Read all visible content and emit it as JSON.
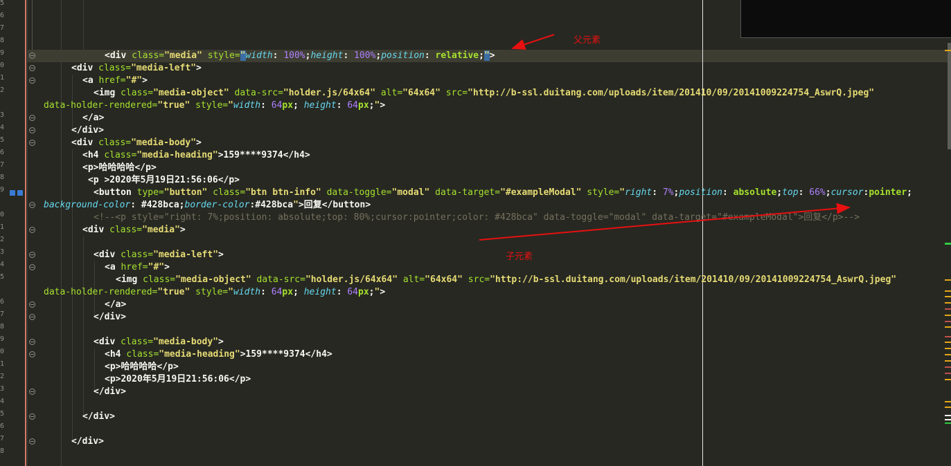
{
  "annotations": {
    "parent_label": "父元素",
    "child_label": "子元素"
  },
  "line_numbers": [
    "5",
    "6",
    "7",
    "8",
    "9",
    "0",
    "1",
    "2",
    "",
    "3",
    "4",
    "5",
    "6",
    "7",
    "8",
    "9",
    "",
    "0",
    "1",
    "2",
    "3",
    "4",
    "5",
    "",
    "6",
    "7",
    "8",
    "9",
    "0",
    "1",
    "2",
    "3",
    "4",
    "5",
    "6",
    "7",
    "8"
  ],
  "colors": {
    "background": "#272822",
    "annotation": "#e81010",
    "tag": "#f8f8f2",
    "attribute": "#a6e22e",
    "string": "#e6db74",
    "property": "#66d9ef",
    "number": "#ae81ff",
    "comment": "#75715e"
  },
  "code": {
    "l05": {
      "t1": "<div ",
      "a1": "class=",
      "s1": "\"media\"",
      "a2": " style=",
      "s2": "\"",
      "p1": "width",
      "t2": ": ",
      "n1": "100%",
      "t3": ";",
      "p2": "height",
      "t4": ": ",
      "n2": "100%",
      "t5": ";",
      "p3": "position",
      "t6": ": ",
      "k1": "relative",
      "t7": ";",
      "s3": "\"",
      "t8": ">"
    },
    "l06": {
      "t1": "<div ",
      "a1": "class=",
      "s1": "\"media-left\"",
      "t2": ">"
    },
    "l07": {
      "t1": "<a ",
      "a1": "href=",
      "s1": "\"#\"",
      "t2": ">"
    },
    "l08": {
      "t1": "<img ",
      "a1": "class=",
      "s1": "\"media-object\"",
      "a2": " data-src=",
      "s2": "\"holder.js/64x64\"",
      "a3": " alt=",
      "s3": "\"64x64\"",
      "a4": " src=",
      "s4": "\"http://b-ssl.duitang.com/uploads/item/201410/09/20141009224754_AswrQ.jpeg\""
    },
    "l08b": {
      "a1": "data-holder-rendered=",
      "s1": "\"true\"",
      "a2": " style=",
      "s2": "\"",
      "p1": "width",
      "t1": ": ",
      "n1": "64",
      "k1": "px",
      "t2": "; ",
      "p2": "height",
      "t3": ": ",
      "n2": "64",
      "k2": "px",
      "t4": ";",
      "s3": "\"",
      "t5": ">"
    },
    "l09": {
      "t1": "</a>"
    },
    "l10": {
      "t1": "</div>"
    },
    "l11": {
      "t1": "<div ",
      "a1": "class=",
      "s1": "\"media-body\"",
      "t2": ">"
    },
    "l12": {
      "t1": "<h4 ",
      "a1": "class=",
      "s1": "\"media-heading\"",
      "t2": ">159****9374</h4>"
    },
    "l13": {
      "t1": "<p>哈哈哈哈</p>"
    },
    "l14": {
      "t1": "<p >2020年5月19日21:56:06</p>"
    },
    "l15": {
      "t1": "<button ",
      "a1": "type=",
      "s1": "\"button\"",
      "a2": " class=",
      "s2": "\"btn btn-info\"",
      "a3": " data-toggle=",
      "s3": "\"modal\"",
      "a4": " data-target=",
      "s4": "\"#exampleModal\"",
      "a5": " style=",
      "s5": "\"",
      "p1": "right",
      "t2": ": ",
      "n1": "7%",
      "t3": ";",
      "p2": "position",
      "t4": ": ",
      "k1": "absolute",
      "t5": ";",
      "p3": "top",
      "t6": ": ",
      "n2": "66%",
      "t7": ";",
      "p4": "cursor",
      "t8": ":",
      "k2": "pointer",
      "t9": ";"
    },
    "l15b": {
      "p1": "background-color",
      "t1": ": #428bca;",
      "p2": "border-color",
      "t2": ":#428bca",
      "s1": "\"",
      "t3": ">回复</button>"
    },
    "l16": {
      "c1": "<!--<p style=\"right: 7%;position: absolute;top: 80%;cursor:pointer;color: #428bca\" data-toggle=\"modal\" data-target=\"#exampleModal\">回复</p>-->"
    },
    "l17": {
      "t1": "<div ",
      "a1": "class=",
      "s1": "\"media\"",
      "t2": ">"
    },
    "l19": {
      "t1": "<div ",
      "a1": "class=",
      "s1": "\"media-left\"",
      "t2": ">"
    },
    "l20": {
      "t1": "<a ",
      "a1": "href=",
      "s1": "\"#\"",
      "t2": ">"
    },
    "l21": {
      "t1": "<img ",
      "a1": "class=",
      "s1": "\"media-object\"",
      "a2": " data-src=",
      "s2": "\"holder.js/64x64\"",
      "a3": " alt=",
      "s3": "\"64x64\"",
      "a4": " src=",
      "s4": "\"http://b-ssl.duitang.com/uploads/item/201410/09/20141009224754_AswrQ.jpeg\""
    },
    "l21b": {
      "a1": "data-holder-rendered=",
      "s1": "\"true\"",
      "a2": " style=",
      "s2": "\"",
      "p1": "width",
      "t1": ": ",
      "n1": "64",
      "k1": "px",
      "t2": "; ",
      "p2": "height",
      "t3": ": ",
      "n2": "64",
      "k2": "px",
      "t4": ";",
      "s3": "\"",
      "t5": ">"
    },
    "l22": {
      "t1": "</a>"
    },
    "l23": {
      "t1": "</div>"
    },
    "l25": {
      "t1": "<div ",
      "a1": "class=",
      "s1": "\"media-body\"",
      "t2": ">"
    },
    "l26": {
      "t1": "<h4 ",
      "a1": "class=",
      "s1": "\"media-heading\"",
      "t2": ">159****9374</h4>"
    },
    "l27": {
      "t1": "<p>哈哈哈哈</p>"
    },
    "l28": {
      "t1": "<p>2020年5月19日21:56:06</p>"
    },
    "l29": {
      "t1": "</div>"
    },
    "l31": {
      "t1": "</div>"
    },
    "l33": {
      "t1": "</div>"
    }
  }
}
